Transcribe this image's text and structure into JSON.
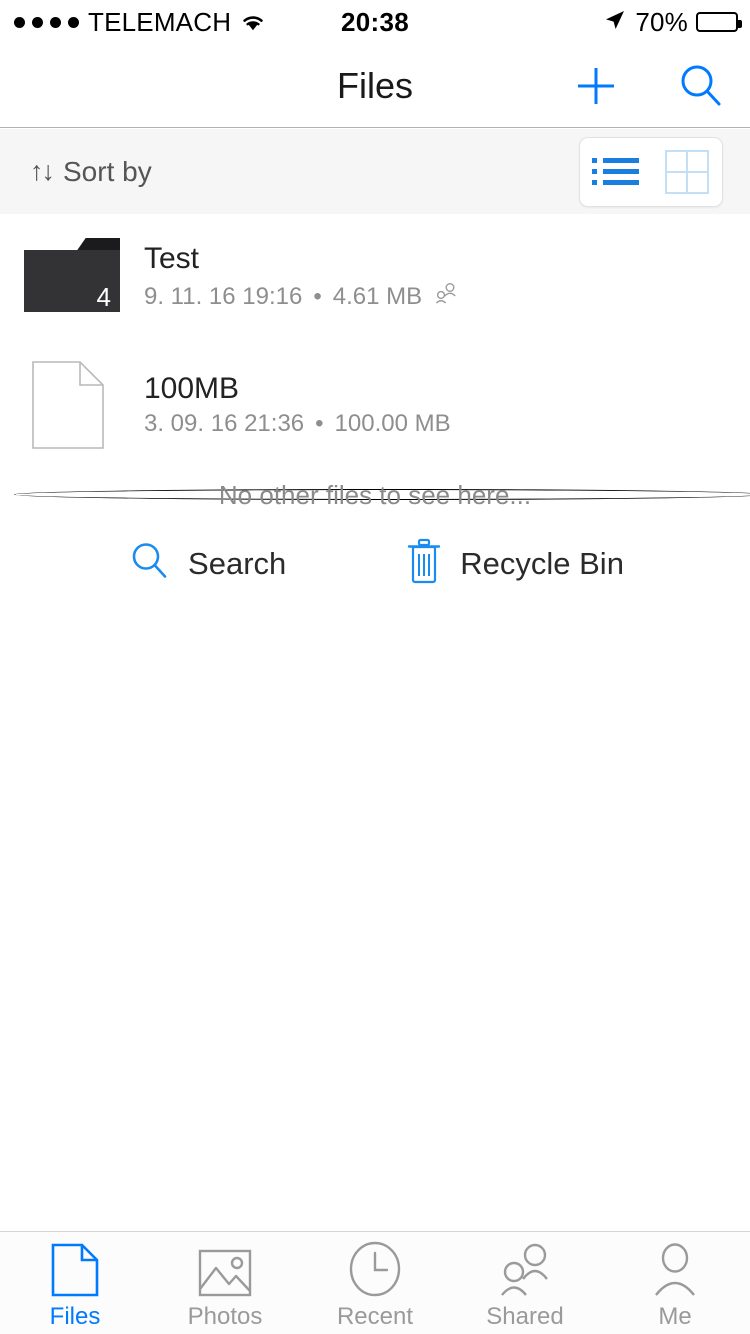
{
  "statusbar": {
    "signal_dots_filled": 4,
    "signal_dots_total": 5,
    "carrier": "TELEMACH",
    "wifi_icon": "wifi-icon",
    "time": "20:38",
    "location_icon": "location-arrow-icon",
    "battery_percent": "70%",
    "battery_level": 70
  },
  "navbar": {
    "title": "Files",
    "add_icon": "plus-icon",
    "search_icon": "search-icon",
    "accent_color": "#007aff"
  },
  "toolbar": {
    "sort_arrows": "↑↓",
    "sort_label": "Sort by",
    "view_list_icon": "list-view-icon",
    "view_grid_icon": "grid-view-icon",
    "active_view": "list",
    "active_color": "#1a7de0",
    "inactive_color": "#c2dff6"
  },
  "files": [
    {
      "icon": "folder-icon",
      "type": "folder",
      "name": "Test",
      "date": "9. 11. 16 19:16",
      "separator": "•",
      "size": "4.61 MB",
      "badge": "4",
      "shared_icon": "shared-people-icon",
      "shared": true
    },
    {
      "icon": "document-icon",
      "type": "file",
      "name": "100MB",
      "date": "3. 09. 16 21:36",
      "separator": "•",
      "size": "100.00 MB",
      "badge": null,
      "shared_icon": null,
      "shared": false
    }
  ],
  "empty_state": {
    "message": "No other files to see here...",
    "actions": [
      {
        "icon": "search-icon",
        "label": "Search"
      },
      {
        "icon": "trash-icon",
        "label": "Recycle Bin"
      }
    ]
  },
  "tabbar": {
    "items": [
      {
        "icon": "document-tab-icon",
        "label": "Files",
        "active": true
      },
      {
        "icon": "photos-tab-icon",
        "label": "Photos",
        "active": false
      },
      {
        "icon": "clock-tab-icon",
        "label": "Recent",
        "active": false
      },
      {
        "icon": "shared-tab-icon",
        "label": "Shared",
        "active": false
      },
      {
        "icon": "person-tab-icon",
        "label": "Me",
        "active": false
      }
    ]
  }
}
